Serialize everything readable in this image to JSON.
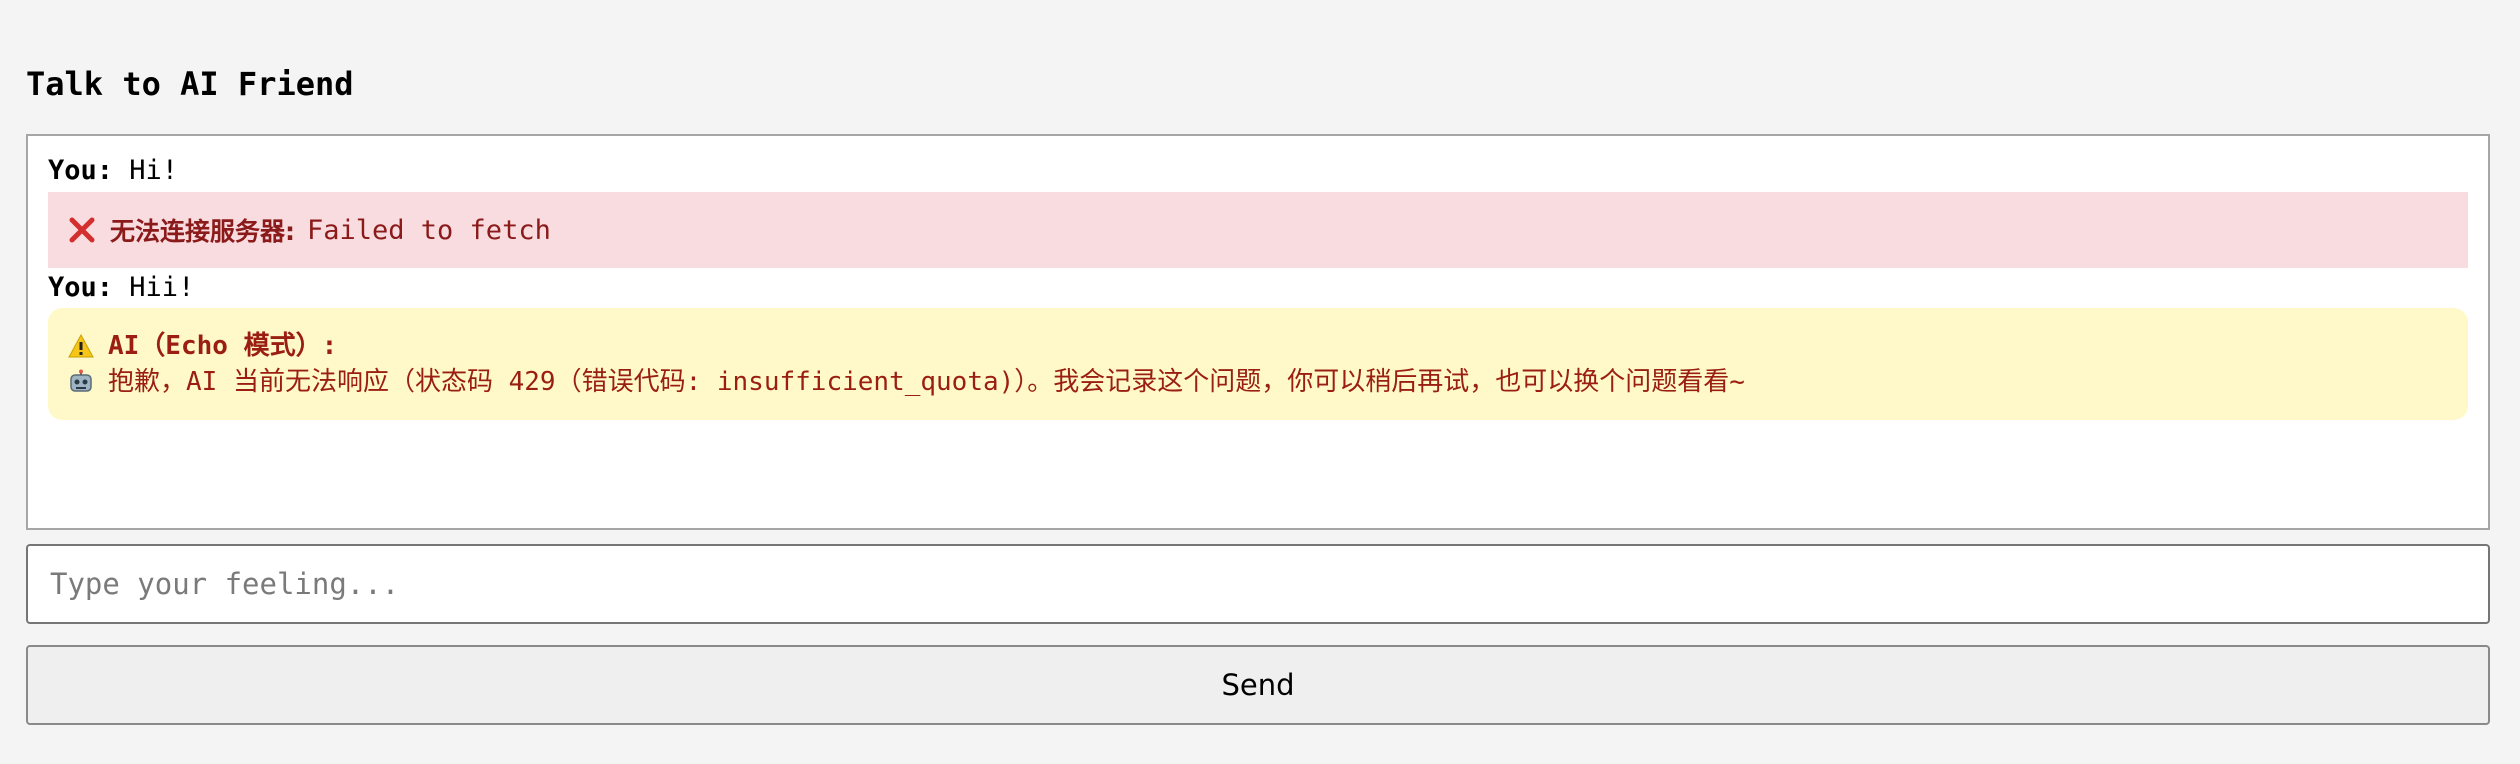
{
  "page": {
    "title": "Talk to AI Friend"
  },
  "chat": {
    "messages": [
      {
        "speaker": "You:",
        "text": "Hi!"
      },
      {
        "icon": "error-x-icon",
        "label": "无法连接服务器:",
        "text": "Failed to fetch"
      },
      {
        "speaker": "You:",
        "text": "Hii!"
      },
      {
        "title_icon": "warning-icon",
        "title": "AI（Echo 模式）:",
        "body_icon": "robot-icon",
        "body": "抱歉，AI 当前无法响应（状态码 429（错误代码: insufficient_quota)）。我会记录这个问题，你可以稍后再试，也可以换个问题看看~"
      }
    ]
  },
  "input": {
    "placeholder": "Type your feeling...",
    "value": ""
  },
  "send_button": {
    "label": "Send"
  },
  "colors": {
    "background": "#f4f4f4",
    "error_bg": "#f9dcdf",
    "error_text": "#8b1a1a",
    "error_icon": "#d32f2f",
    "ai_bg": "#fff9c9",
    "ai_text": "#9a1e12"
  }
}
